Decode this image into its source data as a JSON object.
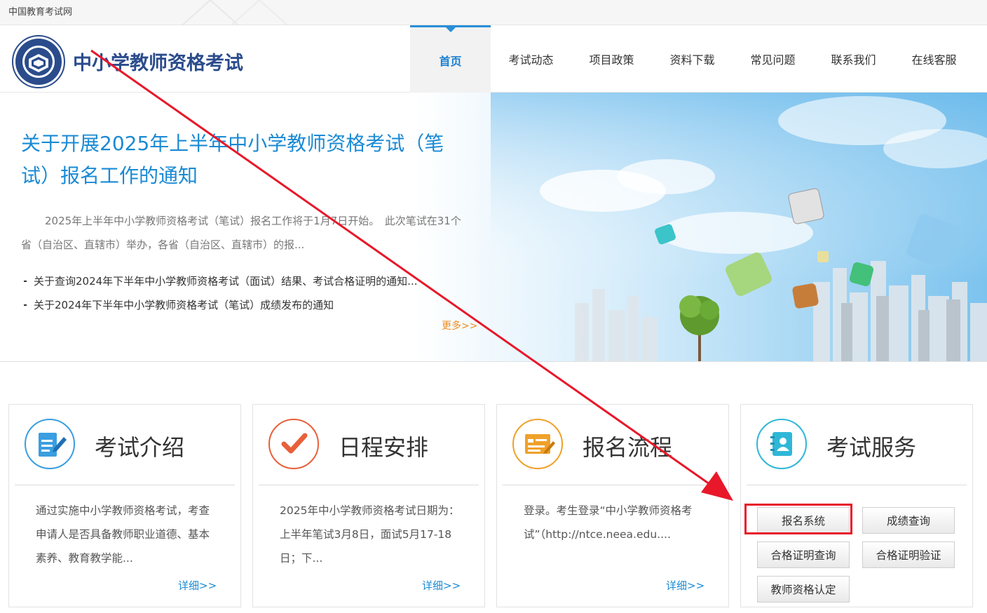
{
  "topbar": {
    "site_name": "中国教育考试网"
  },
  "header": {
    "logo_title": "中小学教师资格考试",
    "nav": [
      {
        "label": "首页",
        "active": true
      },
      {
        "label": "考试动态"
      },
      {
        "label": "项目政策"
      },
      {
        "label": "资料下载"
      },
      {
        "label": "常见问题"
      },
      {
        "label": "联系我们"
      },
      {
        "label": "在线客服"
      }
    ]
  },
  "banner": {
    "headline": "关于开展2025年上半年中小学教师资格考试（笔试）报名工作的通知",
    "summary": "2025年上半年中小学教师资格考试（笔试）报名工作将于1月7日开始。　此次笔试在31个省（自治区、直辖市）举办，各省（自治区、直辖市）的报...",
    "news": [
      "关于查询2024年下半年中小学教师资格考试（面试）结果、考试合格证明的通知...",
      "关于2024年下半年中小学教师资格考试（笔试）成绩发布的通知"
    ],
    "more_label": "更多>>"
  },
  "cards": [
    {
      "title": "考试介绍",
      "icon": "edit-document-icon",
      "desc": "通过实施中小学教师资格考试，考查申请人是否具备教师职业道德、基本素养、教育教学能...",
      "more": "详细>>"
    },
    {
      "title": "日程安排",
      "icon": "checkmark-icon",
      "desc": "2025年中小学教师资格考试日期为：上半年笔试3月8日，面试5月17-18日；下...",
      "more": "详细>>"
    },
    {
      "title": "报名流程",
      "icon": "registration-form-icon",
      "desc": "登录。考生登录“中小学教师资格考试”（http://ntce.neea.edu....",
      "more": "详细>>"
    },
    {
      "title": "考试服务",
      "icon": "address-book-icon"
    }
  ],
  "services": {
    "registration": "报名系统",
    "score_query": "成绩查询",
    "certificate_query": "合格证明查询",
    "certificate_verify": "合格证明验证",
    "teacher_certification": "教师资格认定"
  },
  "colors": {
    "accent_blue": "#1a8ad4",
    "logo_blue": "#2b4c8c",
    "more_orange": "#f08c1e",
    "annotation_red": "#e8182a"
  }
}
